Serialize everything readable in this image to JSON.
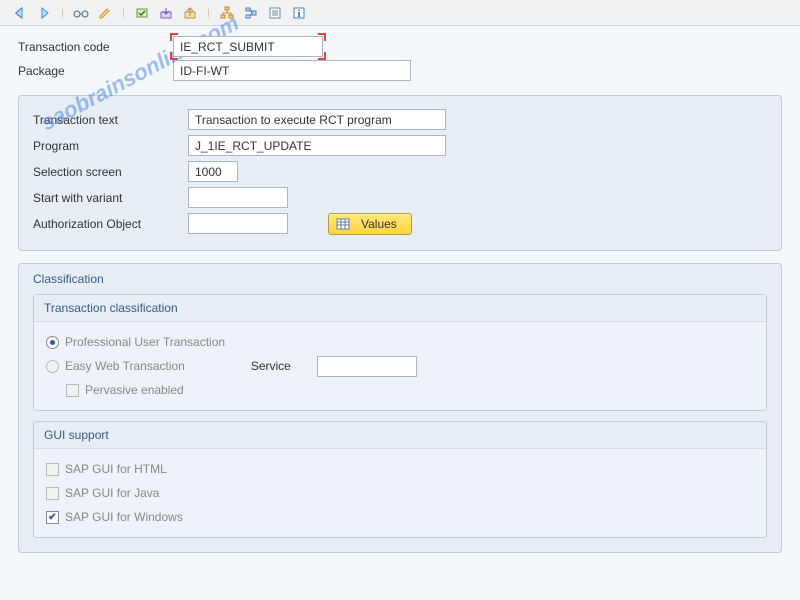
{
  "header": {
    "transaction_code_label": "Transaction code",
    "transaction_code": "IE_RCT_SUBMIT",
    "package_label": "Package",
    "package": "ID-FI-WT"
  },
  "detail": {
    "transaction_text_label": "Transaction text",
    "transaction_text": "Transaction to execute RCT program",
    "program_label": "Program",
    "program": "J_1IE_RCT_UPDATE",
    "selection_screen_label": "Selection screen",
    "selection_screen": "1000",
    "start_with_variant_label": "Start with variant",
    "start_with_variant": "",
    "authorization_object_label": "Authorization Object",
    "authorization_object": "",
    "values_btn": "Values"
  },
  "classification": {
    "title": "Classification",
    "tx_class_title": "Transaction classification",
    "opt_professional": "Professional User Transaction",
    "opt_easy_web": "Easy Web Transaction",
    "service_label": "Service",
    "service_value": "",
    "opt_pervasive": "Pervasive enabled",
    "gui_title": "GUI support",
    "gui_html": "SAP GUI for HTML",
    "gui_java": "SAP GUI for Java",
    "gui_win": "SAP GUI for Windows"
  },
  "watermark": "saobrainsonline.com"
}
